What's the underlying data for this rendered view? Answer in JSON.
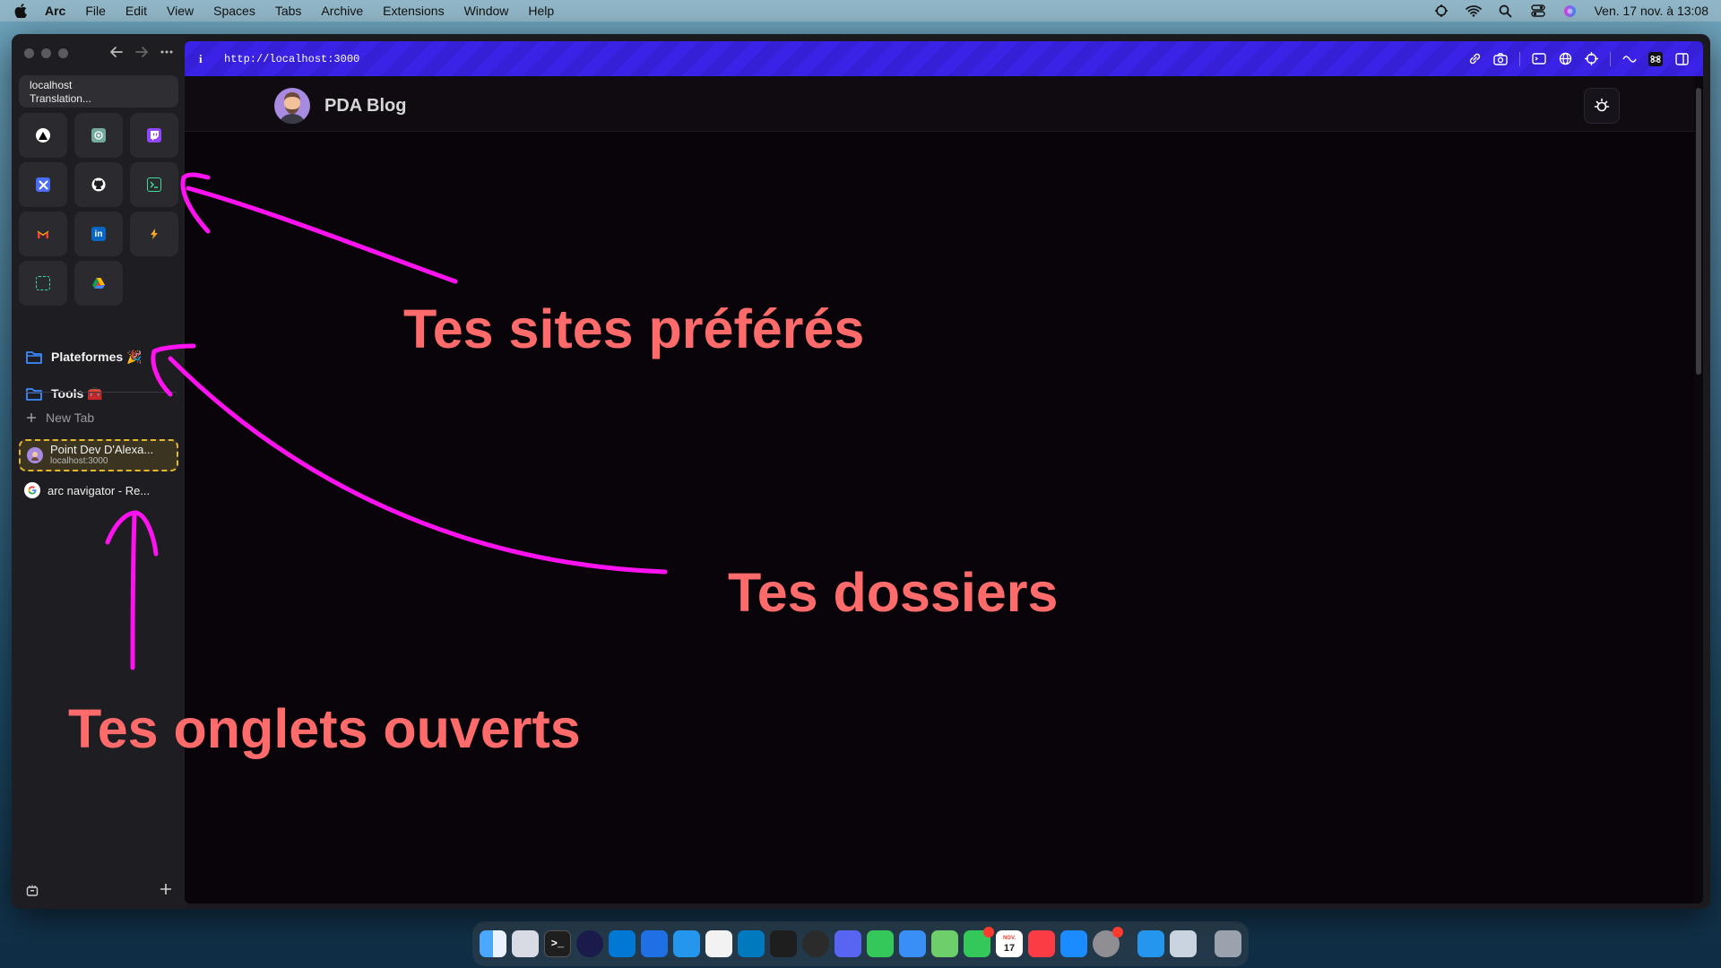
{
  "menubar": {
    "app": "Arc",
    "items": [
      "File",
      "Edit",
      "View",
      "Spaces",
      "Tabs",
      "Archive",
      "Extensions",
      "Window",
      "Help"
    ],
    "datetime": "Ven. 17 nov. à 13:08"
  },
  "sidebar": {
    "url_host": "localhost",
    "url_sub": "Translation...",
    "pinned": [
      "vercel-icon",
      "chatgpt-icon",
      "twitch-icon",
      "toolbox-icon",
      "github-icon",
      "terminal-icon",
      "gmail-icon",
      "linkedin-icon",
      "bolt-icon",
      "box-icon",
      "drive-icon"
    ],
    "folders": [
      {
        "label": "Plateformes 🎉"
      },
      {
        "label": "Tools 🧰"
      }
    ],
    "new_tab": "New Tab",
    "tabs": [
      {
        "title": "Point Dev D'Alexa...",
        "subtitle": "localhost:3000"
      },
      {
        "title": "arc navigator - Re..."
      }
    ]
  },
  "devbar": {
    "info": "i",
    "url": "http://localhost:3000"
  },
  "site": {
    "title": "PDA Blog"
  },
  "annotations": {
    "favorites": "Tes sites préférés",
    "folders": "Tes dossiers",
    "tabs": "Tes onglets ouverts"
  },
  "colors": {
    "devbar": "#3a22e6",
    "annotation_text": "#ff6b6b",
    "annotation_arrow": "#ff12f0",
    "active_tab_border": "#e3b92e"
  },
  "dock": {
    "icons": [
      "finder-icon",
      "launchpad-icon",
      "terminal-icon",
      "arc-browser-icon",
      "vscode-icon",
      "xcode-icon",
      "docker-icon",
      "scrobbles-icon",
      "trello-icon",
      "figma-icon",
      "chatgpt-icon",
      "discord-icon",
      "messages-icon",
      "mail-icon",
      "maps-icon",
      "facetime-icon",
      "calendar-icon",
      "music-icon",
      "app-store-icon",
      "system-settings-icon",
      "docker-alt-icon",
      "preview-icon",
      "trash-icon"
    ],
    "calendar_day": "17",
    "calendar_month": "NOV."
  }
}
